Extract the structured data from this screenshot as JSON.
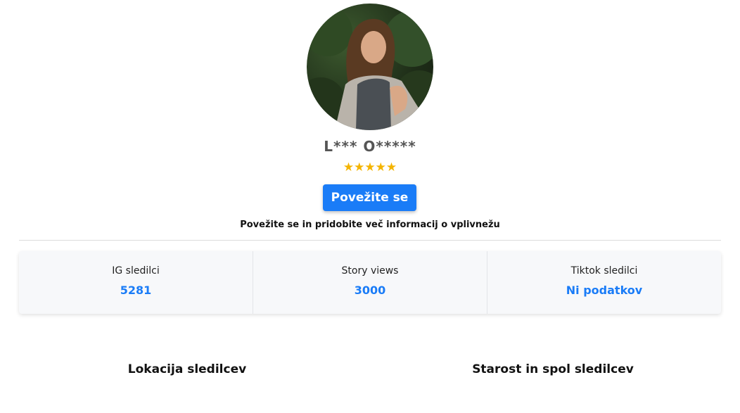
{
  "profile": {
    "name": "L*** O*****",
    "stars": "★★★★★",
    "rating": 5,
    "avatar_icon": "profile-photo"
  },
  "actions": {
    "connect_label": "Povežite se",
    "info_text": "Povežite se in pridobite več informacij o vplivnežu"
  },
  "stats": [
    {
      "label": "IG sledilci",
      "value": "5281"
    },
    {
      "label": "Story views",
      "value": "3000"
    },
    {
      "label": "Tiktok sledilci",
      "value": "Ni podatkov"
    }
  ],
  "sections": {
    "location_title": "Lokacija sledilcev",
    "age_gender_title": "Starost in spol sledilcev"
  },
  "colors": {
    "accent": "#1a7cf7",
    "star": "#f4b400"
  }
}
